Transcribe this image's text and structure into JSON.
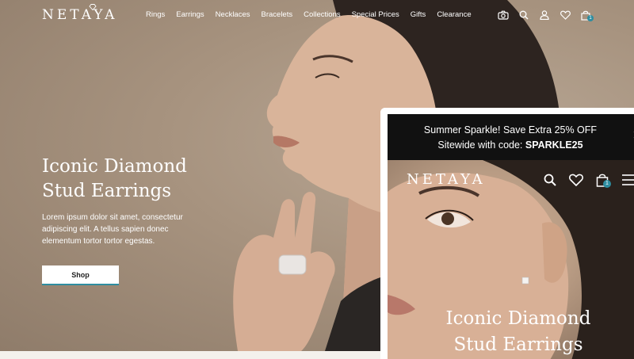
{
  "brand": {
    "name": "NETAYA"
  },
  "nav": {
    "items": [
      "Rings",
      "Earrings",
      "Necklaces",
      "Bracelets",
      "Collections",
      "Special Prices",
      "Gifts",
      "Clearance"
    ],
    "cart_count": "1"
  },
  "hero": {
    "title_line1": "Iconic Diamond",
    "title_line2": "Stud Earrings",
    "description": "Lorem ipsum dolor sit amet, consectetur adipiscing elit. A tellus sapien donec elementum tortor tortor egestas.",
    "cta": "Shop"
  },
  "mobile": {
    "promo_line1": "Summer Sparkle! Save Extra 25% OFF",
    "promo_line2_prefix": "Sitewide with code: ",
    "promo_code": "SPARKLE25",
    "close_glyph": "✕",
    "brand": "NETAYA",
    "cart_count": "1",
    "title_line1": "Iconic Diamond",
    "title_line2": "Stud Earrings"
  },
  "colors": {
    "accent": "#2e8da0",
    "promo_bg": "#111111",
    "hero_bg": "#a7937f"
  },
  "icons": [
    "camera-search-icon",
    "search-icon",
    "user-icon",
    "heart-icon",
    "bag-icon",
    "menu-icon",
    "close-icon"
  ]
}
